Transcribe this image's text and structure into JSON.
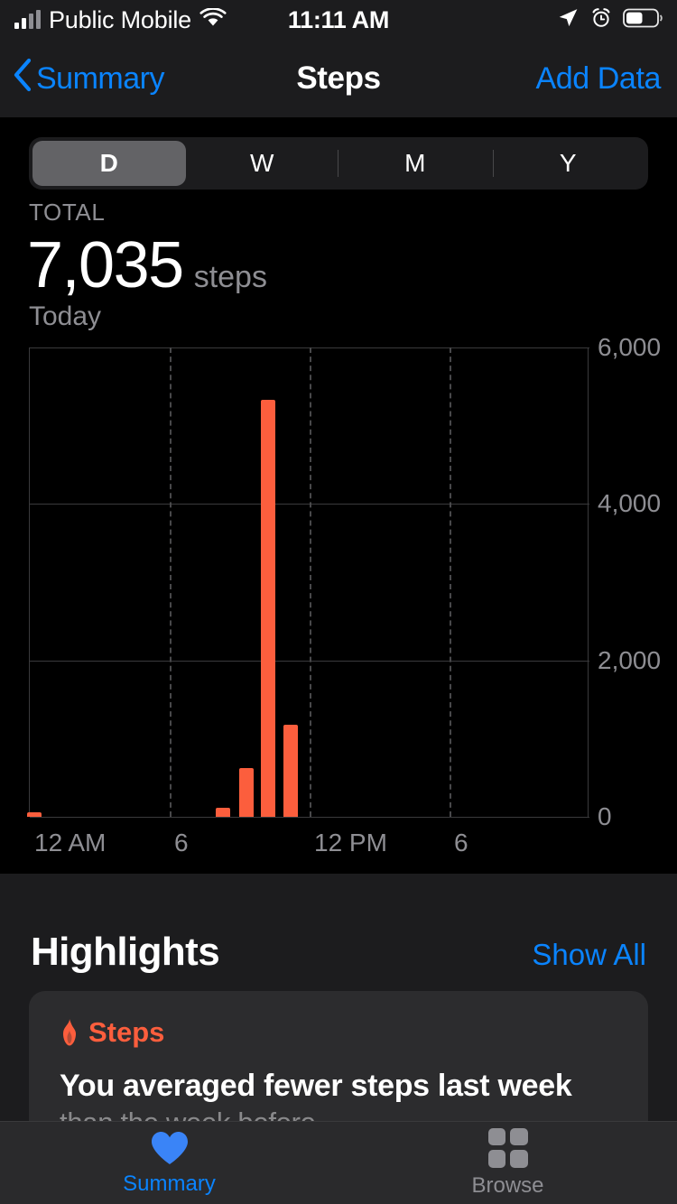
{
  "status_bar": {
    "carrier": "Public Mobile",
    "time": "11:11 AM",
    "icons": [
      "cellular-signal-icon",
      "wifi-icon",
      "location-arrow-icon",
      "alarm-clock-icon",
      "battery-icon"
    ],
    "battery_percent": 50
  },
  "nav": {
    "back_label": "Summary",
    "title": "Steps",
    "action_label": "Add Data"
  },
  "segmented": {
    "options": [
      "D",
      "W",
      "M",
      "Y"
    ],
    "selected": "D"
  },
  "total": {
    "label": "TOTAL",
    "value": "7,035",
    "unit": "steps",
    "date": "Today"
  },
  "chart_data": {
    "type": "bar",
    "title": "Steps",
    "xlabel": "",
    "ylabel": "",
    "ylim": [
      0,
      6000
    ],
    "ytick_labels": [
      "6,000",
      "4,000",
      "2,000",
      "0"
    ],
    "ytick_values": [
      6000,
      4000,
      2000,
      0
    ],
    "xtick_labels": [
      "12 AM",
      "6",
      "12 PM",
      "6"
    ],
    "xtick_values": [
      0,
      6,
      12,
      18
    ],
    "x_range_hours": [
      0,
      24
    ],
    "grid": "horizontal-solid-vertical-dashed",
    "legend": "none",
    "bar_color": "#FC5E3D",
    "x": [
      0.2,
      8.3,
      9.3,
      10.2,
      11.2
    ],
    "values": [
      60,
      110,
      620,
      5330,
      1180
    ],
    "bars": [
      {
        "hour": 0.2,
        "steps": 60
      },
      {
        "hour": 8.3,
        "steps": 110
      },
      {
        "hour": 9.3,
        "steps": 620
      },
      {
        "hour": 10.2,
        "steps": 5330
      },
      {
        "hour": 11.2,
        "steps": 1180
      }
    ]
  },
  "highlights": {
    "title": "Highlights",
    "show_all_label": "Show All",
    "cards": [
      {
        "category": "Steps",
        "category_icon": "flame-icon",
        "category_color": "#FC5E3D",
        "headline": "You averaged fewer steps last week",
        "subline": "than the week before"
      }
    ]
  },
  "tab_bar": {
    "tabs": [
      {
        "label": "Summary",
        "icon": "heart-icon",
        "active": true
      },
      {
        "label": "Browse",
        "icon": "grid-squares-icon",
        "active": false
      }
    ]
  },
  "colors": {
    "accent_blue": "#0A84FF",
    "activity_orange": "#FC5E3D",
    "background": "#000000",
    "surface": "#1C1C1E",
    "card": "#2C2C2E",
    "secondary_text": "#8E8E93"
  }
}
